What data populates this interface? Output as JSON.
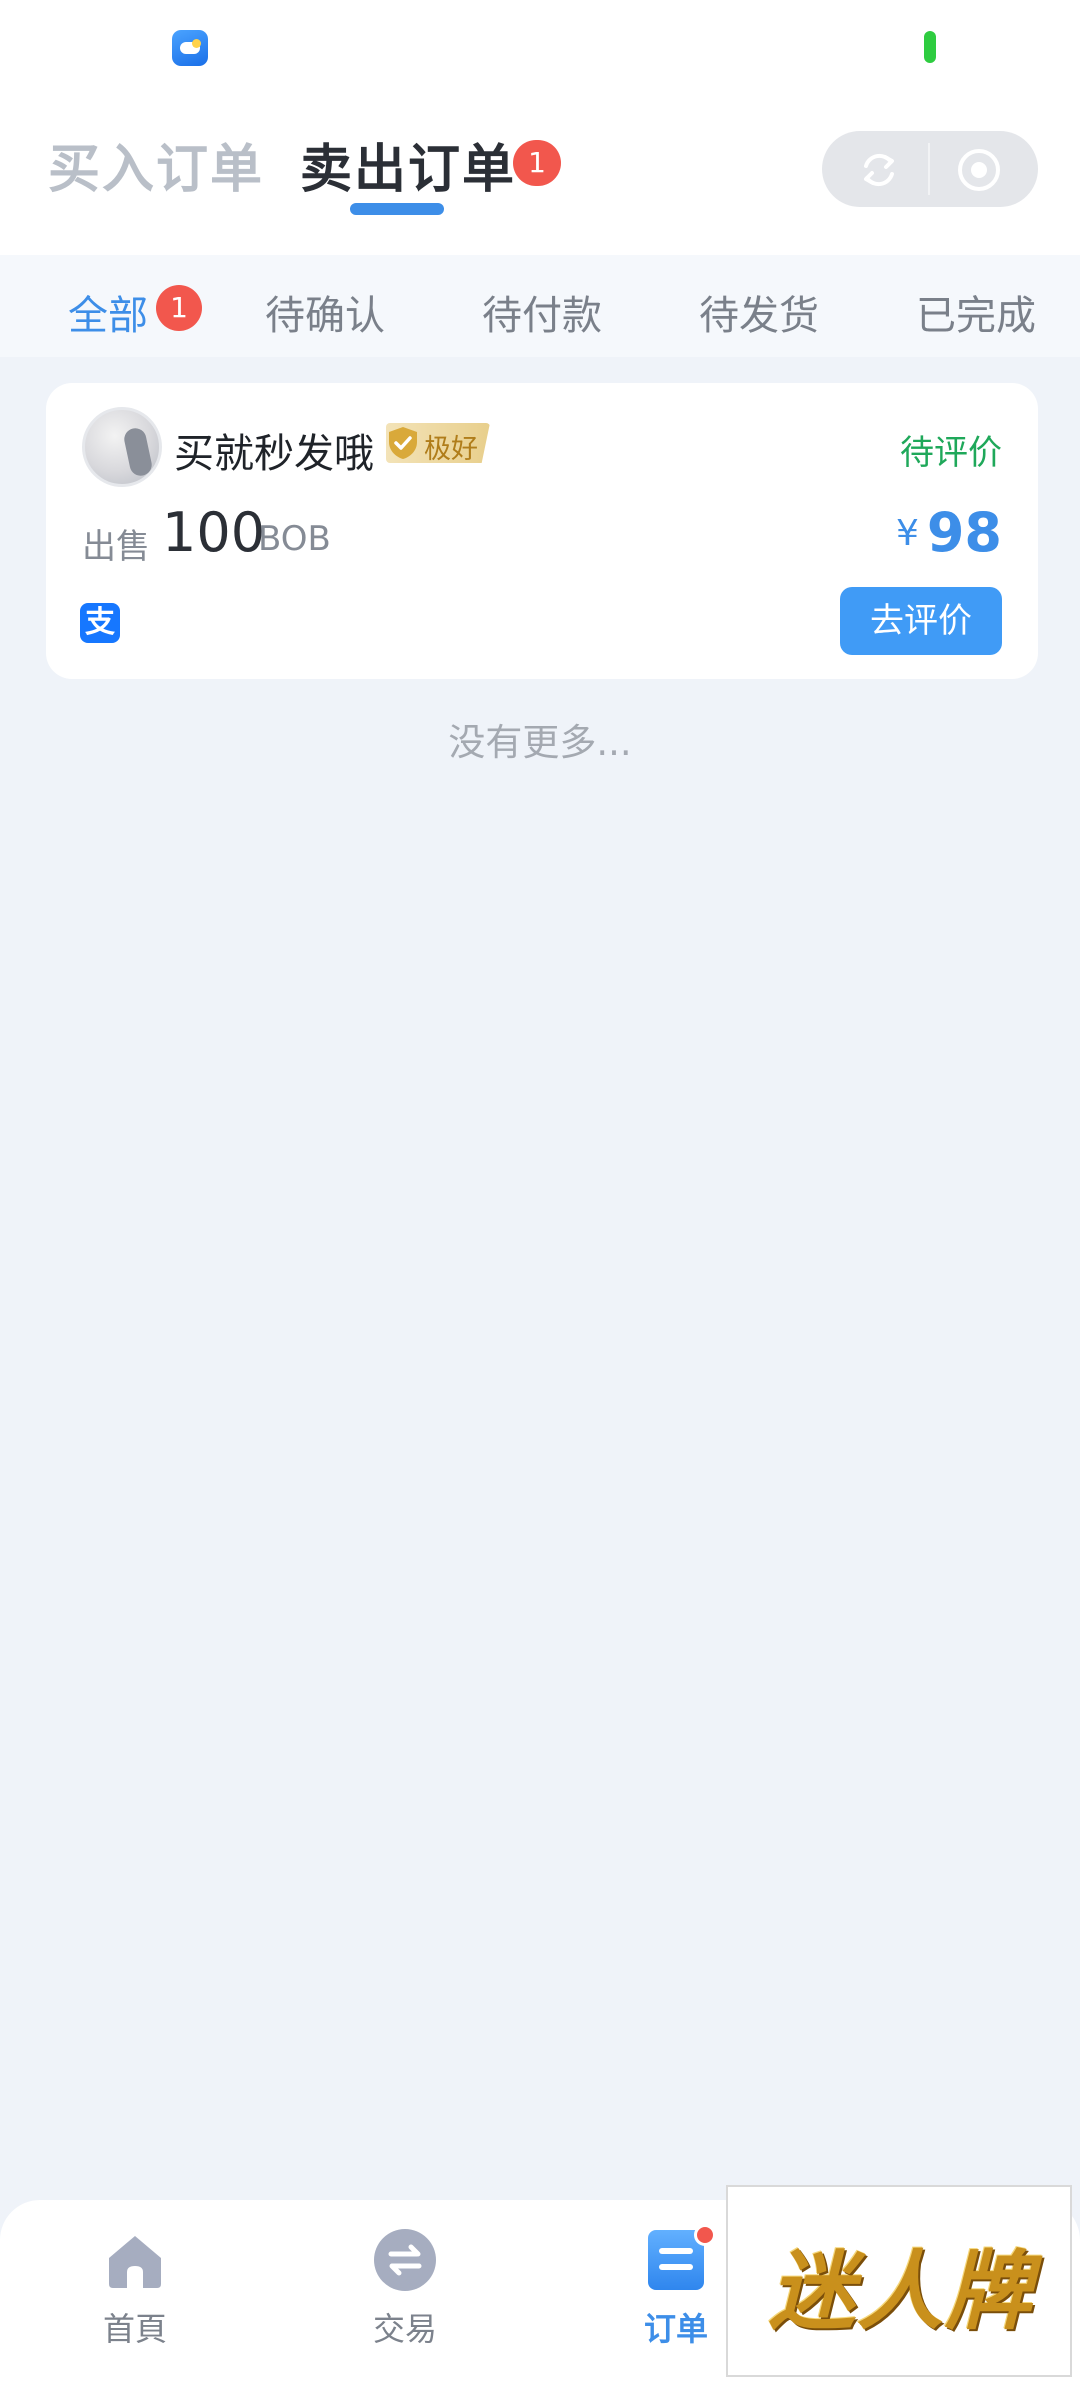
{
  "status_bar": {
    "app_icon": "weather-app-icon",
    "battery": "battery-icon"
  },
  "header": {
    "tabs": [
      {
        "label": "买入订单",
        "active": false
      },
      {
        "label": "卖出订单",
        "active": true,
        "badge": "1"
      }
    ],
    "capsule": {
      "left_icon": "refresh-icon",
      "right_icon": "target-circle-icon"
    }
  },
  "subtabs": [
    {
      "label": "全部",
      "active": true,
      "badge": "1"
    },
    {
      "label": "待确认"
    },
    {
      "label": "待付款"
    },
    {
      "label": "待发货"
    },
    {
      "label": "已完成"
    }
  ],
  "order": {
    "seller_name": "买就秒发哦",
    "rating_label": "极好",
    "status": "待评价",
    "trade_type": "出售",
    "amount": "100",
    "coin": "BOB",
    "price_symbol": "¥",
    "price": "98",
    "payment_method_icon": "alipay-icon",
    "action_label": "去评价"
  },
  "list_end_text": "没有更多...",
  "bottom_nav": [
    {
      "label": "首頁",
      "icon": "home-icon"
    },
    {
      "label": "交易",
      "icon": "exchange-icon"
    },
    {
      "label": "订单",
      "icon": "order-list-icon",
      "active": true,
      "dot": true
    }
  ],
  "watermark": {
    "text": "迷人牌"
  },
  "colors": {
    "accent": "#3d8ee8",
    "badge": "#f2574d",
    "status_green": "#1fa85a",
    "page_bg": "#eff3f9"
  }
}
